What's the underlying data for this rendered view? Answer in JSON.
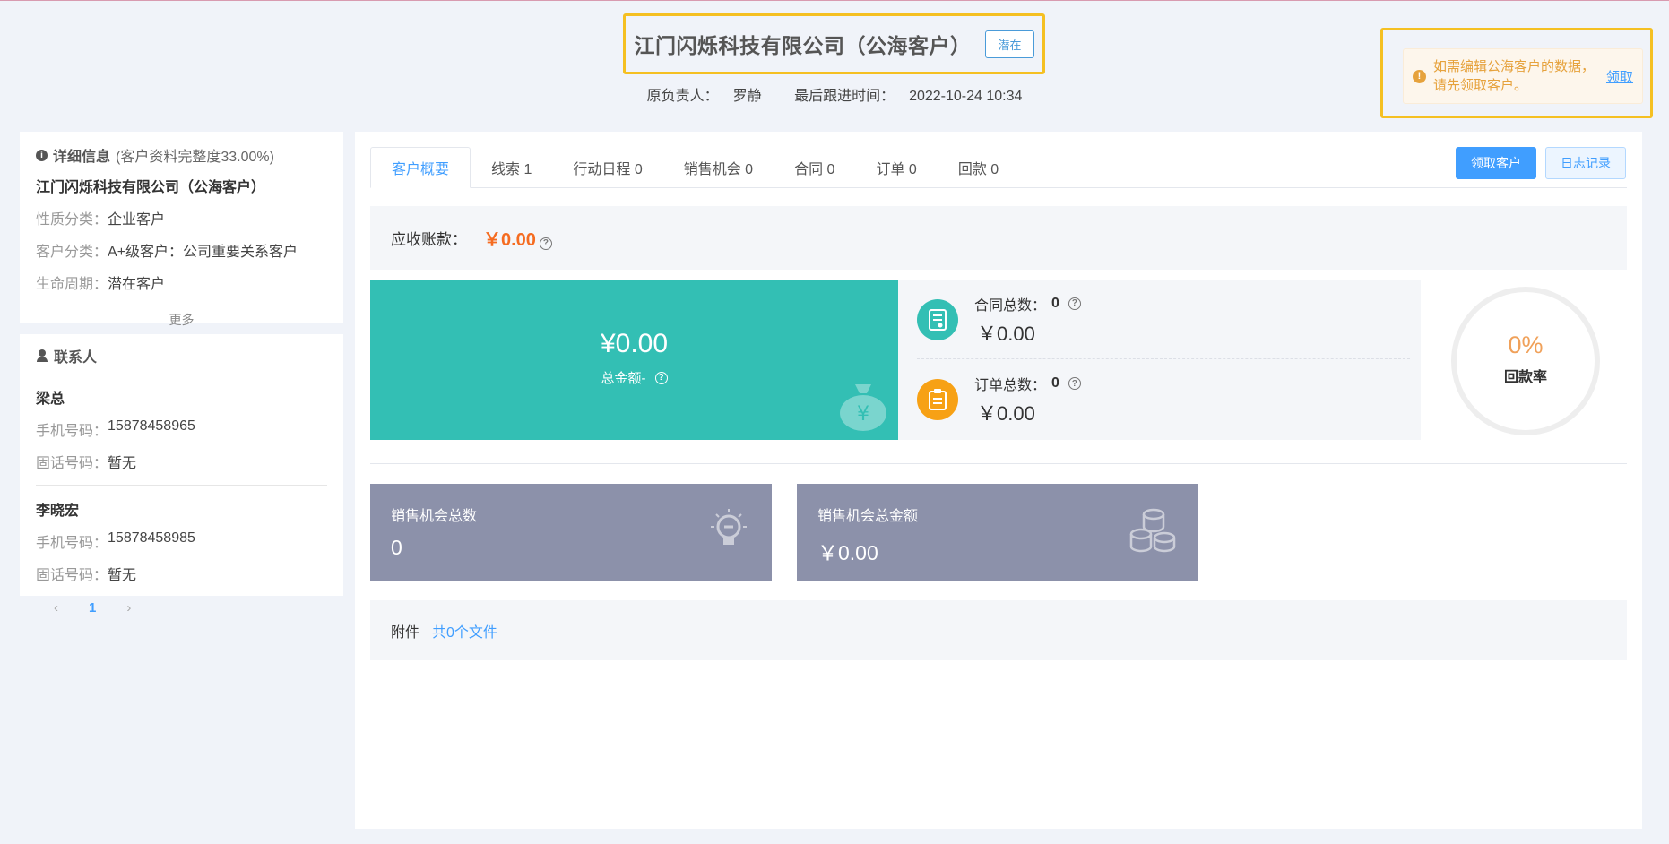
{
  "header": {
    "title": "江门闪烁科技有限公司（公海客户）",
    "status_tag": "潜在",
    "owner_label": "原负责人：",
    "owner": "罗静",
    "last_follow_label": "最后跟进时间：",
    "last_follow": "2022-10-24 10:34"
  },
  "alert": {
    "text": "如需编辑公海客户的数据，请先领取客户。",
    "link": "领取"
  },
  "detail": {
    "heading": "详细信息",
    "completeness": "(客户资料完整度33.00%)",
    "company": "江门闪烁科技有限公司（公海客户）",
    "fields": [
      {
        "key": "性质分类：",
        "value": "企业客户"
      },
      {
        "key": "客户分类：",
        "value": "A+级客户：公司重要关系客户"
      },
      {
        "key": "生命周期：",
        "value": "潜在客户"
      }
    ],
    "more": "更多"
  },
  "contacts": {
    "heading": "联系人",
    "items": [
      {
        "name": "梁总",
        "mobile_label": "手机号码：",
        "mobile": "15878458965",
        "phone_label": "固话号码：",
        "phone": "暂无"
      },
      {
        "name": "李晓宏",
        "mobile_label": "手机号码：",
        "mobile": "15878458985",
        "phone_label": "固话号码：",
        "phone": "暂无"
      }
    ],
    "pager": {
      "prev": "‹",
      "current": "1",
      "next": "›"
    }
  },
  "tabs": [
    {
      "label": "客户概要"
    },
    {
      "label": "线索 1"
    },
    {
      "label": "行动日程 0"
    },
    {
      "label": "销售机会 0"
    },
    {
      "label": "合同 0"
    },
    {
      "label": "订单 0"
    },
    {
      "label": "回款 0"
    }
  ],
  "actions": {
    "claim": "领取客户",
    "log": "日志记录"
  },
  "receivable": {
    "label": "应收账款：",
    "amount": "￥0.00"
  },
  "total": {
    "amount": "¥0.00",
    "label": "总金额-"
  },
  "contract": {
    "label": "合同总数：",
    "count": "0",
    "amount": "￥0.00"
  },
  "order": {
    "label": "订单总数：",
    "count": "0",
    "amount": "￥0.00"
  },
  "payment_rate": {
    "value": "0%",
    "label": "回款率",
    "fraction": 0
  },
  "opportunity": {
    "count_label": "销售机会总数",
    "count": "0",
    "amount_label": "销售机会总金额",
    "amount": "￥0.00"
  },
  "attachment": {
    "label": "附件",
    "files": "共0个文件"
  },
  "colors": {
    "accent": "#409eff",
    "teal": "#33bfb4",
    "orange": "#f7a115",
    "highlight": "#f5c022",
    "card": "#8c91aa"
  }
}
